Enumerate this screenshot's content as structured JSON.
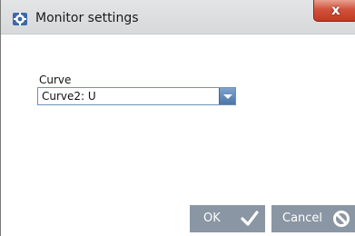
{
  "window": {
    "title": "Monitor settings",
    "close_glyph": "x"
  },
  "form": {
    "curve_label": "Curve",
    "curve_value": "Curve2: U"
  },
  "buttons": {
    "ok_label": "OK",
    "cancel_label": "Cancel"
  },
  "icons": {
    "app": "gear-monitor-icon",
    "ok": "checkmark-icon",
    "cancel": "prohibited-icon",
    "dropdown": "chevron-down-icon"
  },
  "colors": {
    "button_bg": "#8a96a3",
    "dropdown_accent": "#4a76a8",
    "close_red": "#c2391f"
  }
}
